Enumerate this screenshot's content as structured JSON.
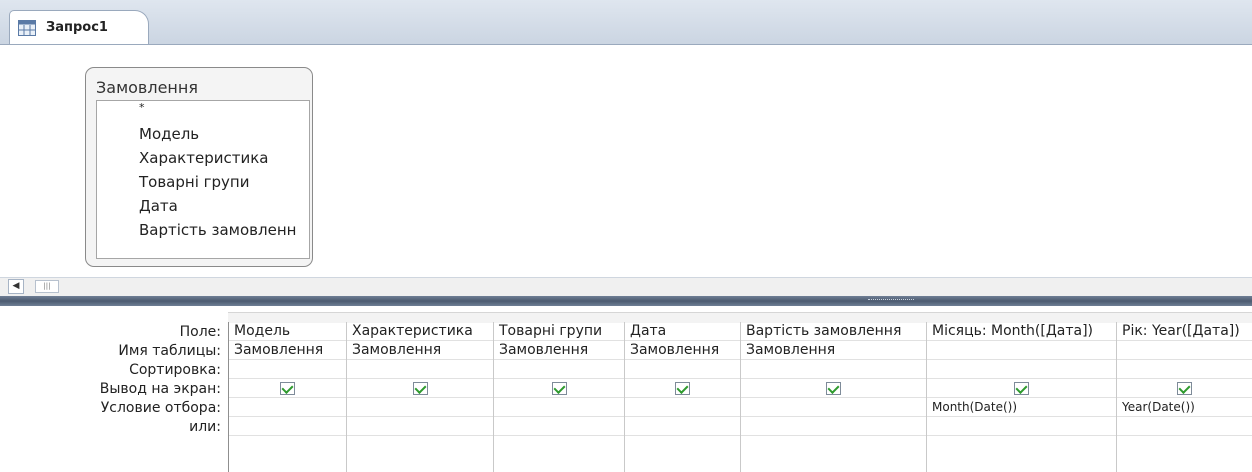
{
  "tab": {
    "label": "Запрос1",
    "icon": "query-icon"
  },
  "table_list": {
    "title": "Замовлення",
    "fields": [
      "*",
      "Модель",
      "Характеристика",
      "Товарні групи",
      "Дата",
      "Вартість замовленн"
    ]
  },
  "grid": {
    "row_labels": [
      "Поле:",
      "Имя таблицы:",
      "Сортировка:",
      "Вывод на экран:",
      "Условие отбора:",
      "или:"
    ],
    "columns": [
      {
        "field": "Модель",
        "table": "Замовлення",
        "sort": "",
        "show": true,
        "criteria": "",
        "or": ""
      },
      {
        "field": "Характеристика",
        "table": "Замовлення",
        "sort": "",
        "show": true,
        "criteria": "",
        "or": ""
      },
      {
        "field": "Товарні групи",
        "table": "Замовлення",
        "sort": "",
        "show": true,
        "criteria": "",
        "or": ""
      },
      {
        "field": "Дата",
        "table": "Замовлення",
        "sort": "",
        "show": true,
        "criteria": "",
        "or": ""
      },
      {
        "field": "Вартість замовлення",
        "table": "Замовлення",
        "sort": "",
        "show": true,
        "criteria": "",
        "or": ""
      },
      {
        "field": "Місяць: Month([Дата])",
        "table": "",
        "sort": "",
        "show": true,
        "criteria": "Month(Date())",
        "or": ""
      },
      {
        "field": "Рік: Year([Дата])",
        "table": "",
        "sort": "",
        "show": true,
        "criteria": "Year(Date())",
        "or": ""
      }
    ]
  },
  "colors": {
    "tab_strip": "#cbd5e2",
    "splitter": "#4c5b70",
    "checkmark": "#2f9b2f"
  }
}
